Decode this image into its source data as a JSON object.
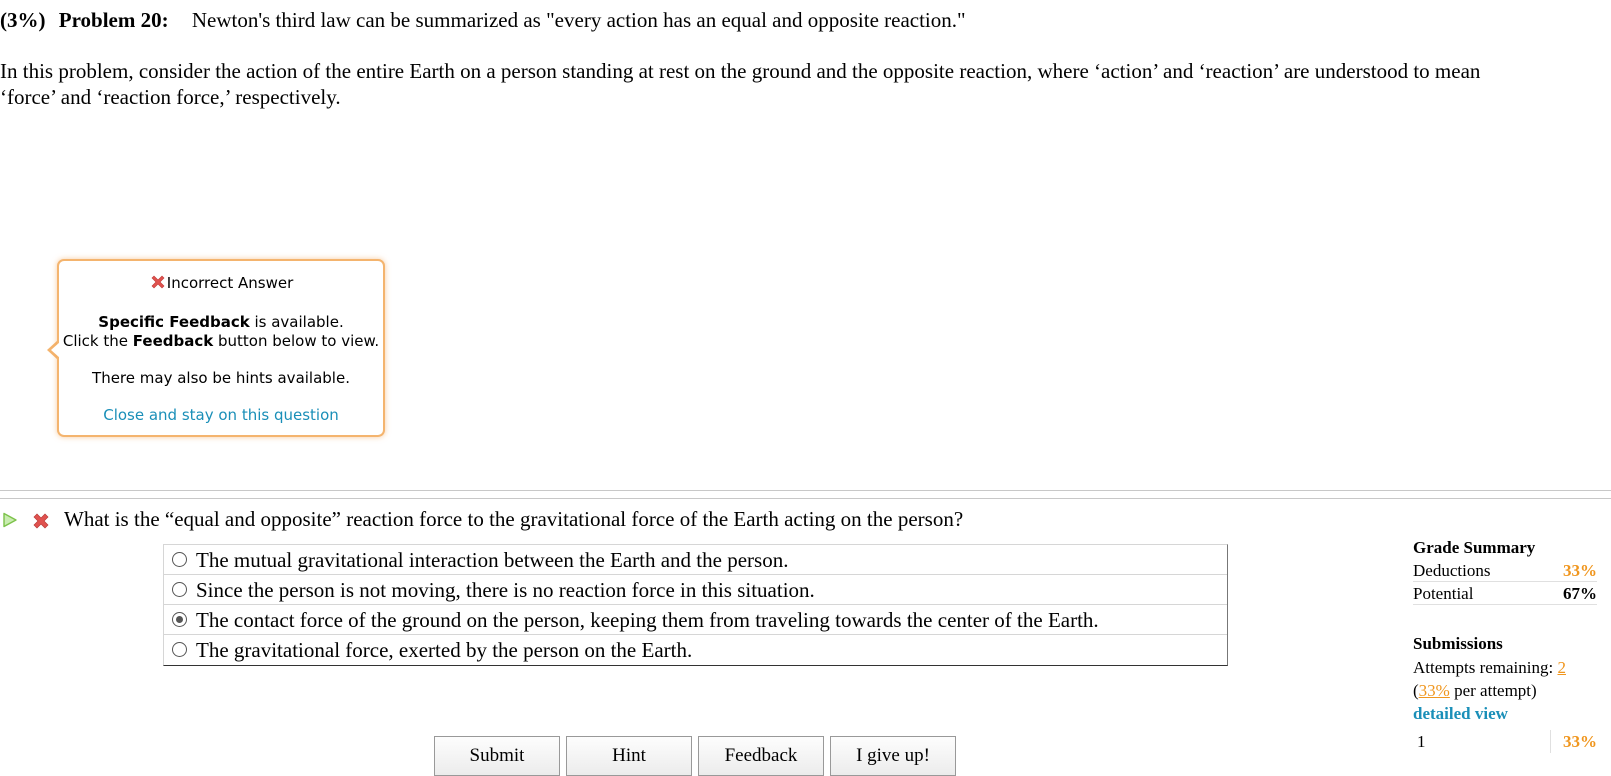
{
  "problem": {
    "percent": "(3%)",
    "title": "Problem 20:",
    "statement": "Newton's third law can be summarized as \"every action has an equal and opposite reaction.\"",
    "intro": "In this problem, consider the action of the entire Earth on a person standing at rest on the ground and the opposite reaction, where ‘action’ and ‘reaction’ are understood to mean ‘force’ and ‘reaction force,’ respectively."
  },
  "popup": {
    "title": "Incorrect Answer",
    "line1_bold": "Specific Feedback",
    "line1_rest": " is available.",
    "line2_pre": "Click the ",
    "line2_bold": "Feedback",
    "line2_post": " button below to view.",
    "line3": "There may also be hints available.",
    "close_link": "Close and stay on this question",
    "border_color": "#f4b46e"
  },
  "question": {
    "text": "What is the “equal and opposite” reaction force to the gravitational force of the Earth acting on the person?",
    "status_icon": "wrong-x-icon",
    "options": [
      {
        "label": "The mutual gravitational interaction between the Earth and the person.",
        "selected": false
      },
      {
        "label": "Since the person is not moving, there is no reaction force in this situation.",
        "selected": false
      },
      {
        "label": "The contact force of the ground on the person, keeping them from traveling towards the center of the Earth.",
        "selected": true
      },
      {
        "label": "The gravitational force, exerted by the person on the Earth.",
        "selected": false
      }
    ]
  },
  "buttons": {
    "submit": "Submit",
    "hint": "Hint",
    "feedback": "Feedback",
    "give_up": "I give up!"
  },
  "grade_summary": {
    "title": "Grade Summary",
    "deductions_label": "Deductions",
    "deductions_value": "33%",
    "potential_label": "Potential",
    "potential_value": "67%"
  },
  "submissions": {
    "title": "Submissions",
    "attempts_label": "Attempts remaining: ",
    "attempts_value": "2",
    "per_open": "(",
    "per_value": "33%",
    "per_close": " per attempt)",
    "detailed_link": "detailed view",
    "history": [
      {
        "attempt": "1",
        "deduction": "33%"
      }
    ]
  },
  "colors": {
    "accent_orange": "#f0961e",
    "link_blue": "#1a8fb8",
    "wrong_red": "#e0524f",
    "play_green": "#7cc24a"
  }
}
